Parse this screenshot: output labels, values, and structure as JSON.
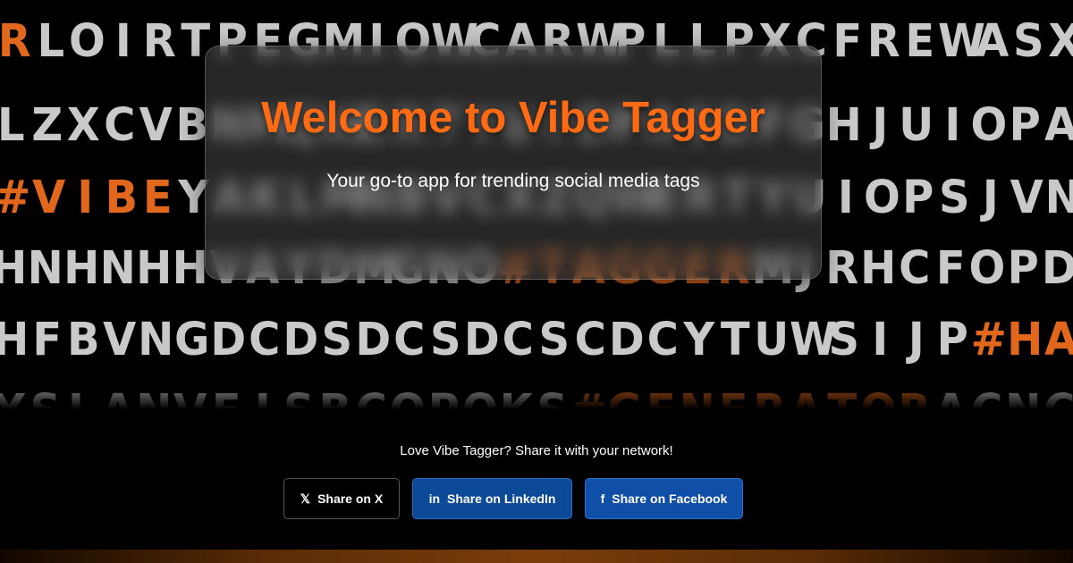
{
  "background": {
    "rows": [
      {
        "segments": [
          {
            "text": "R",
            "hl": true
          },
          {
            "text": "LOIRTPEGMIOWCARWPLLPXCFREWASXC",
            "hl": false
          }
        ]
      },
      {
        "segments": [
          {
            "text": "LZXCVBNMQWERTYUIOPASDFGHJUIOPASDF",
            "hl": false
          }
        ]
      },
      {
        "segments": [
          {
            "text": "#VIBE",
            "hl": true
          },
          {
            "text": "YAKLMNBVCXZQWERTYUIOPSJVNGFIP",
            "hl": false
          }
        ]
      },
      {
        "segments": [
          {
            "text": "HNHNHHVAYDMGNO",
            "hl": false
          },
          {
            "text": "#TAGGER",
            "hl": true
          },
          {
            "text": "MJRHCFOPD",
            "hl": false
          }
        ]
      },
      {
        "segments": [
          {
            "text": "HFBVNGDCDSDCSDCSCDCYTUWSIJP",
            "hl": false
          },
          {
            "text": "#HA",
            "hl": true
          }
        ]
      },
      {
        "segments": [
          {
            "text": "YSLANVFISBCOPOKS",
            "hl": false
          },
          {
            "text": "#GENERATOR",
            "hl": true
          },
          {
            "text": "ACNCR",
            "hl": false
          }
        ]
      }
    ],
    "colors": {
      "plain": "#c9c9c9",
      "highlight": "#e0671c"
    }
  },
  "hero": {
    "title": "Welcome to Vibe Tagger",
    "subtitle": "Your go-to app for trending social media tags",
    "title_color": "#ff6a13"
  },
  "share": {
    "prompt": "Love Vibe Tagger? Share it with your network!",
    "buttons": [
      {
        "label": "Share on X",
        "icon": "x-logo-icon",
        "glyph": "𝕏",
        "bg": "#000000"
      },
      {
        "label": "Share on LinkedIn",
        "icon": "linkedin-icon",
        "glyph": "in",
        "bg": "#0c4a97"
      },
      {
        "label": "Share on Facebook",
        "icon": "facebook-icon",
        "glyph": "f",
        "bg": "#0f4fa8"
      }
    ]
  }
}
